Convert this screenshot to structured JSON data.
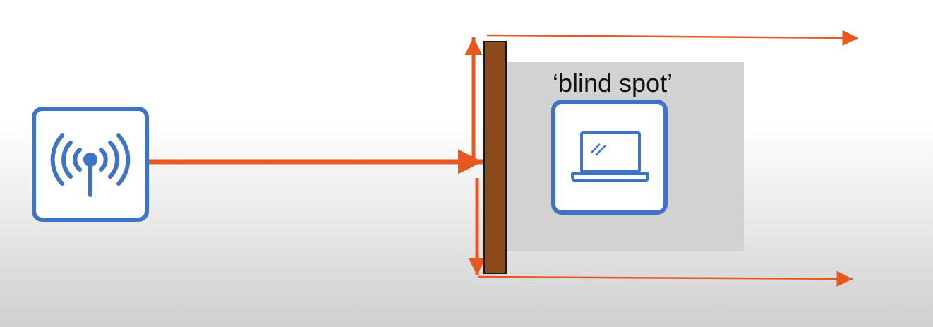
{
  "diagram": {
    "blind_spot_label": "‘blind spot’",
    "nodes": [
      {
        "id": "access-point",
        "icon": "wireless-antenna-icon"
      },
      {
        "id": "wall",
        "icon": "wall"
      },
      {
        "id": "laptop",
        "icon": "laptop-icon"
      }
    ],
    "colors": {
      "arrow": "#e8571f",
      "icon_blue": "#3f73c5",
      "wall_fill": "#8b4a1c",
      "blind_spot_fill": "#d2d2d2"
    }
  }
}
